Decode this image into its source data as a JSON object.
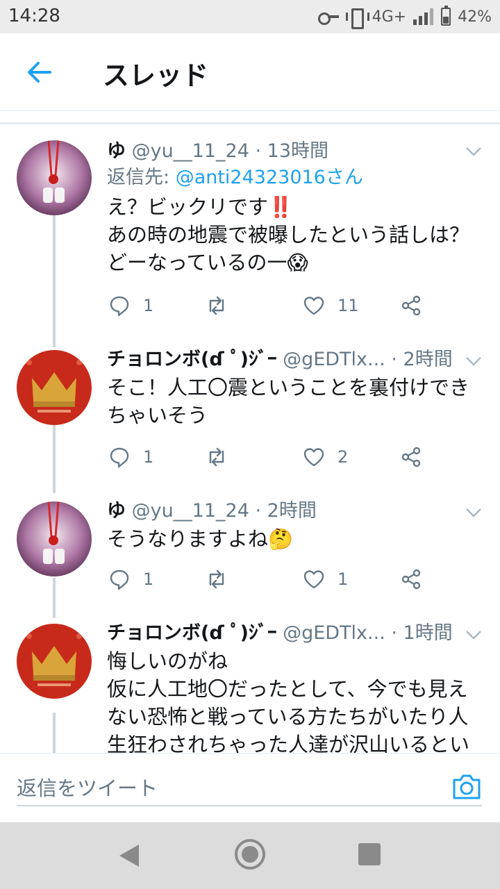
{
  "status_bar": {
    "time": "14:28",
    "network": "4G+",
    "battery": "42%",
    "icons": [
      "key-icon",
      "vibrate-icon",
      "signal-icon",
      "battery-icon"
    ]
  },
  "header": {
    "title": "スレッド",
    "back_icon": "arrow-left-icon"
  },
  "tweets": [
    {
      "name": "ゆ",
      "handle": "@yu__11_24",
      "time": "· 13時間",
      "reply_prefix": "返信先: ",
      "reply_to": "@anti24323016さん",
      "text": "え？ビックリです‼️\nあの時の地震で被曝したという話しは？\nどーなっているの一😱",
      "replies": "1",
      "retweets": "",
      "likes": "11"
    },
    {
      "name": "チョロンボ(ɗ ﾟ)ｼﾞｰ",
      "handle": "@gEDTlx...",
      "time": "· 2時間",
      "text": "そこ！人工〇震ということを裏付けできちゃいそう",
      "replies": "1",
      "retweets": "",
      "likes": "2"
    },
    {
      "name": "ゆ",
      "handle": "@yu__11_24",
      "time": "· 2時間",
      "text": "そうなりますよね🤔",
      "replies": "1",
      "retweets": "",
      "likes": "1"
    },
    {
      "name": "チョロンボ(ɗ ﾟ)ｼﾞｰ",
      "handle": "@gEDTlx...",
      "time": "· 1時間",
      "text": "悔しいのがね\n仮に人工地〇だったとして、今でも見えない恐怖と戦っている方たちがいたり人生狂わされちゃった人達が沢山いるとい"
    }
  ],
  "reply_bar": {
    "placeholder": "返信をツイート",
    "camera_icon": "camera-icon"
  },
  "colors": {
    "accent": "#1da1f2",
    "secondary_text": "#657786",
    "thread_line": "#ccd6dd"
  }
}
